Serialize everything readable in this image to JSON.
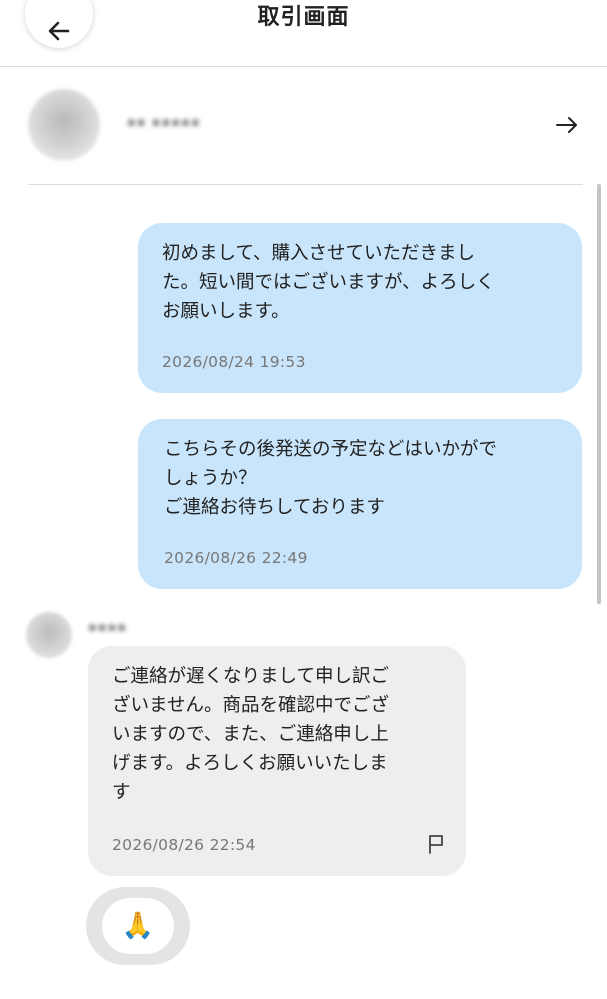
{
  "header": {
    "title": "取引画面",
    "back_icon": "arrow-left-icon"
  },
  "user": {
    "name": "▪▪ ▪▪▪▪▪",
    "avatar_icon": "avatar",
    "arrow_icon": "arrow-right-icon"
  },
  "messages": [
    {
      "direction": "outgoing",
      "text": "初めまして、購入させていただきまし\nた。短い間ではございますが、よろしく\nお願いします。",
      "time": "2026/08/24 19:53"
    },
    {
      "direction": "outgoing",
      "text": "こちらその後発送の予定などはいかがで\nしょうか？\nご連絡お待ちしております",
      "time": "2026/08/26 22:49"
    },
    {
      "direction": "incoming",
      "sender": "▪▪▪▪",
      "text": "ご連絡が遅くなりまして申し訳ご\nざいません。商品を確認中でござ\nいますので、また、ご連絡申し上\nげます。よろしくお願いいたしま\nす",
      "time": "2026/08/26 22:54",
      "report_icon": "flag-icon"
    }
  ],
  "reaction": {
    "emoji": "🙏"
  },
  "colors": {
    "outgoing_bubble": "#c9e5fb",
    "incoming_bubble": "#eeeeee",
    "timestamp": "#777777"
  }
}
